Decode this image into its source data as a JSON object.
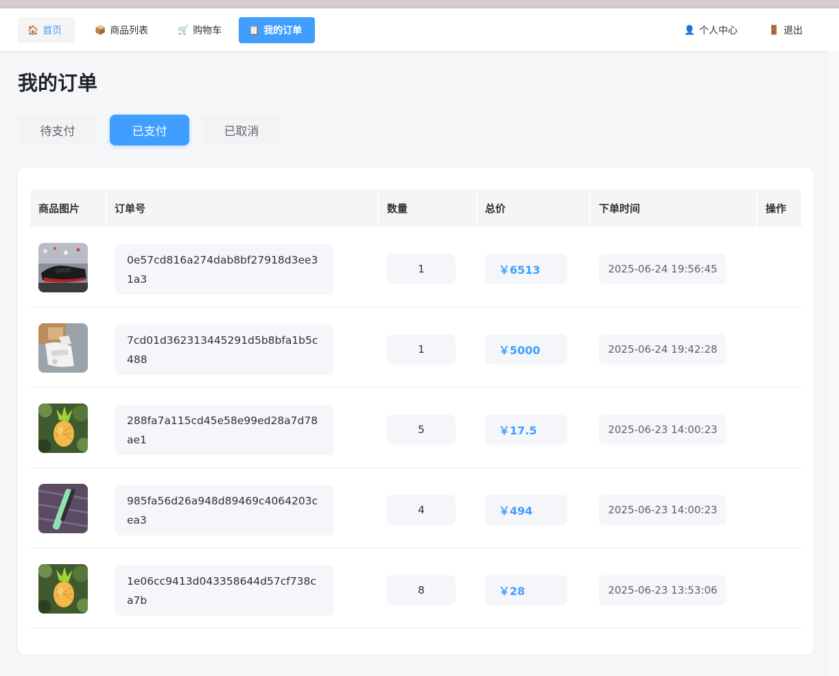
{
  "nav": {
    "home": {
      "label": "首页",
      "icon": "house-icon"
    },
    "products": {
      "label": "商品列表",
      "icon": "package-icon"
    },
    "cart": {
      "label": "购物车",
      "icon": "cart-icon"
    },
    "orders": {
      "label": "我的订单",
      "icon": "clipboard-icon"
    },
    "user": {
      "label": "个人中心",
      "icon": "user-icon"
    },
    "logout": {
      "label": "退出",
      "icon": "door-icon"
    }
  },
  "page_title": "我的订单",
  "tabs": [
    {
      "label": "待支付",
      "active": false
    },
    {
      "label": "已支付",
      "active": true
    },
    {
      "label": "已取消",
      "active": false
    }
  ],
  "table": {
    "headers": [
      "商品图片",
      "订单号",
      "数量",
      "总价",
      "下单时间",
      "操作"
    ],
    "rows": [
      {
        "image": "black-sneaker",
        "order_no": "0e57cd816a274dab8bf27918d3ee31a3",
        "qty": "1",
        "price": "￥6513",
        "time": "2025-06-24 19:56:45"
      },
      {
        "image": "white-sneaker",
        "order_no": "7cd01d362313445291d5b8bfa1b5c488",
        "qty": "1",
        "price": "￥5000",
        "time": "2025-06-24 19:42:28"
      },
      {
        "image": "pineapple-toy",
        "order_no": "288fa7a115cd45e58e99ed28a7d78ae1",
        "qty": "5",
        "price": "￥17.5",
        "time": "2025-06-23 14:00:23"
      },
      {
        "image": "green-pen",
        "order_no": "985fa56d26a948d89469c4064203cea3",
        "qty": "4",
        "price": "￥494",
        "time": "2025-06-23 14:00:23"
      },
      {
        "image": "pineapple-toy",
        "order_no": "1e06cc9413d043358644d57cf738ca7b",
        "qty": "8",
        "price": "￥28",
        "time": "2025-06-23 13:53:06"
      }
    ]
  },
  "colors": {
    "accent": "#409eff",
    "background": "#f5f6f8"
  }
}
